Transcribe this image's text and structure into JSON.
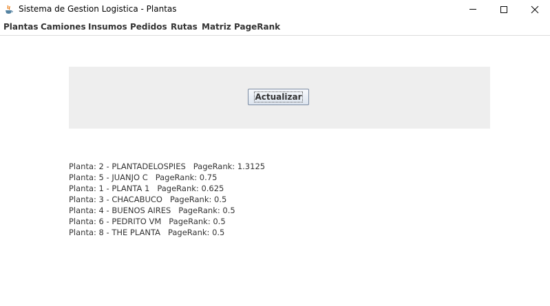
{
  "window": {
    "title": "Sistema de Gestion Logistica - Plantas",
    "icon": "java-icon",
    "controls": [
      "minimize-icon",
      "maximize-icon",
      "close-icon"
    ]
  },
  "menu": {
    "items": [
      "Plantas",
      "Camiones",
      "Insumos",
      "Pedidos",
      "Rutas",
      "Matriz",
      "PageRank"
    ]
  },
  "panel": {
    "refresh_label": "Actualizar"
  },
  "results": [
    {
      "text": "Planta: 2 - PLANTADELOSPIES   PageRank: 1.3125"
    },
    {
      "text": "Planta: 5 - JUANJO C   PageRank: 0.75"
    },
    {
      "text": "Planta: 1 - PLANTA 1   PageRank: 0.625"
    },
    {
      "text": "Planta: 3 - CHACABUCO   PageRank: 0.5"
    },
    {
      "text": "Planta: 4 - BUENOS AIRES   PageRank: 0.5"
    },
    {
      "text": "Planta: 6 - PEDRITO VM   PageRank: 0.5"
    },
    {
      "text": "Planta: 8 - THE PLANTA   PageRank: 0.5"
    }
  ],
  "colors": {
    "panel_bg": "#eeeeee",
    "button_border": "#7a8aa0",
    "text": "#333333"
  }
}
